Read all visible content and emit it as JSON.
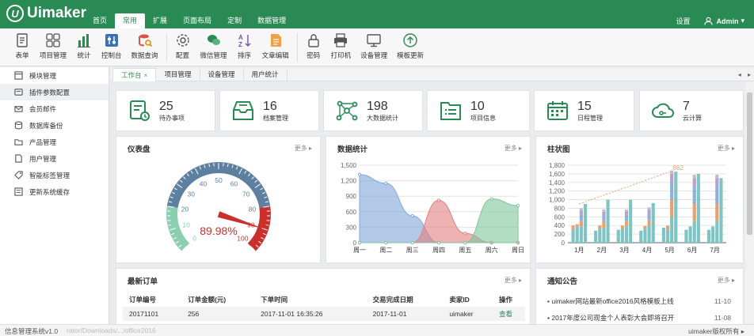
{
  "app": {
    "logo_text": "Uimaker",
    "logo_mark": "U"
  },
  "menu": [
    "首页",
    "常用",
    "扩展",
    "页面布局",
    "定制",
    "数据管理"
  ],
  "menu_active": 1,
  "topright": {
    "settings": "设置",
    "user": "Admin",
    "caret": "▾"
  },
  "ribbon": [
    {
      "label": "表单",
      "icon": "form-icon"
    },
    {
      "label": "项目管理",
      "icon": "grid-icon",
      "caret": true
    },
    {
      "label": "统计",
      "icon": "bar-chart-icon"
    },
    {
      "label": "控制台",
      "icon": "sliders-icon",
      "caret": true
    },
    {
      "label": "数据查询",
      "icon": "database-search-icon",
      "caret": true
    },
    {
      "label": "配置",
      "icon": "gear-icon"
    },
    {
      "label": "微信管理",
      "icon": "wechat-icon",
      "caret": true
    },
    {
      "label": "排序",
      "icon": "sort-icon"
    },
    {
      "label": "文章编辑",
      "icon": "document-icon",
      "caret": true
    },
    {
      "label": "密码",
      "icon": "lock-icon"
    },
    {
      "label": "打印机",
      "icon": "printer-icon"
    },
    {
      "label": "设备管理",
      "icon": "monitor-icon"
    },
    {
      "label": "模板更新",
      "icon": "upload-icon"
    }
  ],
  "sidebar": [
    {
      "label": "模块管理",
      "icon": "module-icon"
    },
    {
      "label": "插件参数配置",
      "icon": "plugin-icon",
      "active": true
    },
    {
      "label": "会员邮件",
      "icon": "mail-icon"
    },
    {
      "label": "数据库备份",
      "icon": "database-icon"
    },
    {
      "label": "产品管理",
      "icon": "folder-icon"
    },
    {
      "label": "用户管理",
      "icon": "doc-icon"
    },
    {
      "label": "智能标签管理",
      "icon": "tag-icon"
    },
    {
      "label": "更新系统缓存",
      "icon": "cache-icon"
    }
  ],
  "tabs": [
    {
      "label": "工作台",
      "close": "×",
      "active": true
    },
    {
      "label": "项目管理"
    },
    {
      "label": "设备管理"
    },
    {
      "label": "用户统计"
    }
  ],
  "tabnav": {
    "prev": "◂",
    "next": "▸"
  },
  "stats": [
    {
      "num": "25",
      "label": "待办事项",
      "icon": "todo-icon"
    },
    {
      "num": "16",
      "label": "档案管理",
      "icon": "archive-icon"
    },
    {
      "num": "198",
      "label": "大数据统计",
      "icon": "network-icon"
    },
    {
      "num": "10",
      "label": "项目信息",
      "icon": "list-folder-icon"
    },
    {
      "num": "15",
      "label": "日程管理",
      "icon": "calendar-icon"
    },
    {
      "num": "7",
      "label": "云计算",
      "icon": "cloud-icon"
    }
  ],
  "more": "更多 ▸",
  "gauge": {
    "title": "仪表盘",
    "value": 89.98,
    "value_text": "89.98%",
    "ticks": [
      "0",
      "10",
      "20",
      "30",
      "40",
      "50",
      "60",
      "70",
      "80",
      "90",
      "100"
    ]
  },
  "chart_data": [
    {
      "type": "area",
      "title": "数据统计",
      "categories": [
        "周一",
        "周二",
        "周三",
        "周四",
        "周五",
        "周六",
        "周日"
      ],
      "yticks": [
        "0",
        "300",
        "600",
        "900",
        "1,200",
        "1,500"
      ],
      "ylim": [
        0,
        1500
      ],
      "series": [
        {
          "values": [
            1320,
            1150,
            520,
            0,
            0,
            0,
            0
          ],
          "color": "#7fa6d9"
        },
        {
          "values": [
            0,
            0,
            0,
            820,
            180,
            0,
            0
          ],
          "color": "#e37f7f"
        },
        {
          "values": [
            0,
            0,
            0,
            0,
            0,
            850,
            720
          ],
          "color": "#7fc49c"
        }
      ],
      "grid": true
    },
    {
      "type": "bar",
      "title": "柱状图",
      "categories": [
        "1月",
        "2月",
        "3月",
        "4月",
        "5月",
        "6月",
        "7月"
      ],
      "yticks": [
        "0",
        "200",
        "400",
        "600",
        "800",
        "1,000",
        "1,200",
        "1,400",
        "1,600",
        "1,800"
      ],
      "ylim": [
        0,
        1800
      ],
      "colors": [
        "#7fc4c4",
        "#e8a070",
        "#8fb0d9",
        "#b5a0d0",
        "#c0c0c0"
      ],
      "groups": [
        [
          [
            300,
            100,
            0,
            0,
            0
          ],
          [
            380,
            50,
            0,
            0,
            0
          ],
          [
            380,
            120,
            150,
            100,
            50
          ],
          [
            900,
            0,
            0,
            0,
            0
          ]
        ],
        [
          [
            280,
            0,
            0,
            0,
            0
          ],
          [
            320,
            80,
            0,
            0,
            0
          ],
          [
            350,
            150,
            100,
            120,
            50
          ],
          [
            1000,
            0,
            0,
            0,
            0
          ]
        ],
        [
          [
            300,
            0,
            0,
            0,
            0
          ],
          [
            320,
            80,
            0,
            0,
            0
          ],
          [
            380,
            120,
            150,
            80,
            40
          ],
          [
            1000,
            0,
            0,
            0,
            0
          ]
        ],
        [
          [
            280,
            0,
            0,
            0,
            0
          ],
          [
            330,
            60,
            0,
            0,
            0
          ],
          [
            400,
            120,
            150,
            100,
            50
          ],
          [
            920,
            0,
            0,
            0,
            0
          ]
        ],
        [
          [
            350,
            0,
            0,
            0,
            0
          ],
          [
            300,
            100,
            0,
            0,
            0
          ],
          [
            600,
            400,
            400,
            200,
            80
          ],
          [
            1650,
            0,
            0,
            0,
            0
          ]
        ],
        [
          [
            300,
            0,
            0,
            0,
            0
          ],
          [
            380,
            0,
            0,
            0,
            0
          ],
          [
            500,
            400,
            400,
            200,
            80
          ],
          [
            1600,
            0,
            0,
            0,
            0
          ]
        ],
        [
          [
            300,
            0,
            0,
            0,
            0
          ],
          [
            380,
            0,
            0,
            0,
            0
          ],
          [
            500,
            400,
            400,
            200,
            80
          ],
          [
            1500,
            0,
            0,
            0,
            0
          ]
        ]
      ],
      "annotation": {
        "text": "862",
        "category": "5月",
        "value": 1650
      },
      "trend": [
        {
          "category": "1月",
          "value": 900
        },
        {
          "category": "5月",
          "value": 1650
        }
      ],
      "grid": true
    }
  ],
  "orders": {
    "title": "最新订单",
    "columns": [
      "订单编号",
      "订单金额(元)",
      "下单时间",
      "交易完成日期",
      "卖家ID",
      "操作"
    ],
    "rows": [
      [
        "20171101",
        "256",
        "2017-11-01 16:35:26",
        "2017-11-01",
        "uimaker",
        "查看"
      ]
    ]
  },
  "notice": {
    "title": "通知公告",
    "items": [
      {
        "text": "uimaker网站最新office2016风格模板上线",
        "date": "11-10"
      },
      {
        "text": "2017年度公司现金个人表彰大会即将召开",
        "date": "11-08"
      }
    ]
  },
  "status": {
    "left": "信息管理系统v1.0",
    "path": "rator/Downloads/.../office2016",
    "right": "uimaker版权所有 ▸"
  },
  "colors": {
    "brand": "#2a8a54",
    "link": "#2a8a54"
  }
}
